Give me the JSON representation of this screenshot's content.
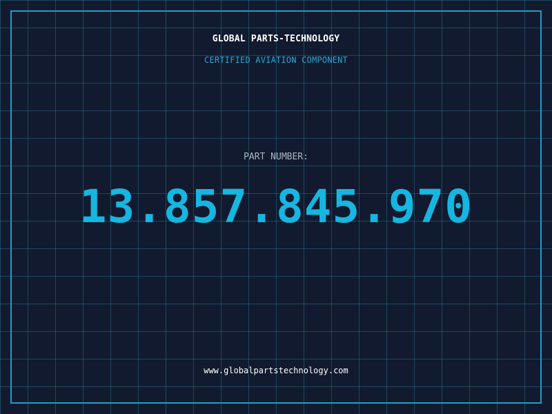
{
  "brand": {
    "name": "GLOBAL PARTS-TECHNOLOGY",
    "tagline": "CERTIFIED AVIATION COMPONENT"
  },
  "part": {
    "label": "PART NUMBER:",
    "number": "13.857.845.970"
  },
  "footer": {
    "website": "www.globalpartstechnology.com"
  },
  "colors": {
    "background": "#111a2e",
    "grid": "#286e8c",
    "accent": "#16b6e0",
    "frame": "#1f9fc7",
    "label": "#aeb7c4",
    "text": "#ffffff"
  }
}
